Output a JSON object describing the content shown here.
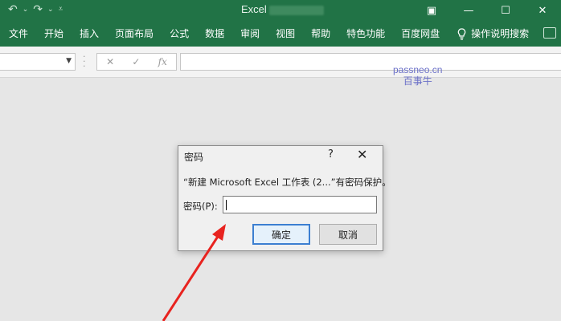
{
  "titlebar": {
    "app_title": "Excel",
    "qat": {
      "undo_icon": "undo-icon",
      "redo_icon": "redo-icon",
      "customize_icon": "customize-qat-icon"
    },
    "window_buttons": {
      "ribbon_display": "▣",
      "minimize": "—",
      "maximize": "☐",
      "close": "✕"
    }
  },
  "ribbon": {
    "tabs": [
      "文件",
      "开始",
      "插入",
      "页面布局",
      "公式",
      "数据",
      "审阅",
      "视图",
      "帮助",
      "特色功能",
      "百度网盘"
    ],
    "tell_me": "操作说明搜索"
  },
  "formula_bar": {
    "cancel_symbol": "✕",
    "enter_symbol": "✓",
    "fx_label": "fx"
  },
  "watermark": {
    "line1": "passneo.cn",
    "line2": "百事牛"
  },
  "dialog": {
    "title": "密码",
    "help": "?",
    "close": "✕",
    "message": "“新建 Microsoft Excel 工作表 (2...”有密码保护。",
    "password_label": "密码(P):",
    "password_value": "",
    "ok_label": "确定",
    "cancel_label": "取消"
  },
  "colors": {
    "excel_green": "#217346",
    "annotation_arrow": "#e8231f"
  }
}
